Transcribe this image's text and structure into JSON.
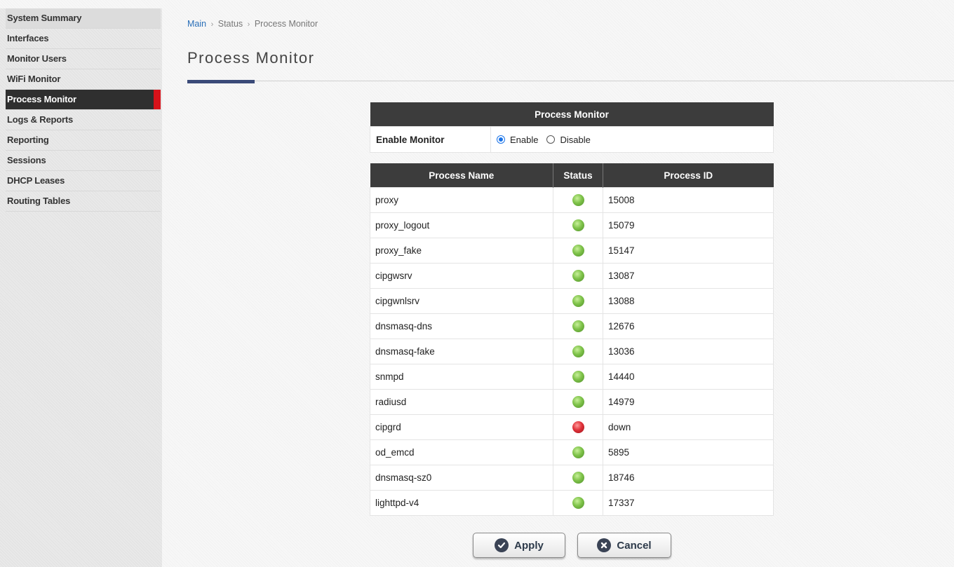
{
  "sidebar": {
    "items": [
      {
        "label": "System Summary"
      },
      {
        "label": "Interfaces"
      },
      {
        "label": "Monitor Users"
      },
      {
        "label": "WiFi Monitor"
      },
      {
        "label": "Process Monitor",
        "active": true
      },
      {
        "label": "Logs & Reports"
      },
      {
        "label": "Reporting"
      },
      {
        "label": "Sessions"
      },
      {
        "label": "DHCP Leases"
      },
      {
        "label": "Routing Tables"
      }
    ]
  },
  "breadcrumb": {
    "main": "Main",
    "sep1": "›",
    "status": "Status",
    "sep2": "›",
    "current": "Process Monitor"
  },
  "page_title": "Process Monitor",
  "monitor": {
    "header": "Process Monitor",
    "enable_label": "Enable Monitor",
    "enable_option": "Enable",
    "disable_option": "Disable",
    "selected": "Enable"
  },
  "processes": {
    "columns": [
      "Process Name",
      "Status",
      "Process ID"
    ],
    "rows": [
      {
        "name": "proxy",
        "status": "up",
        "pid": "15008"
      },
      {
        "name": "proxy_logout",
        "status": "up",
        "pid": "15079"
      },
      {
        "name": "proxy_fake",
        "status": "up",
        "pid": "15147"
      },
      {
        "name": "cipgwsrv",
        "status": "up",
        "pid": "13087"
      },
      {
        "name": "cipgwnlsrv",
        "status": "up",
        "pid": "13088"
      },
      {
        "name": "dnsmasq-dns",
        "status": "up",
        "pid": "12676"
      },
      {
        "name": "dnsmasq-fake",
        "status": "up",
        "pid": "13036"
      },
      {
        "name": "snmpd",
        "status": "up",
        "pid": "14440"
      },
      {
        "name": "radiusd",
        "status": "up",
        "pid": "14979"
      },
      {
        "name": "cipgrd",
        "status": "down",
        "pid": "down"
      },
      {
        "name": "od_emcd",
        "status": "up",
        "pid": "5895"
      },
      {
        "name": "dnsmasq-sz0",
        "status": "up",
        "pid": "18746"
      },
      {
        "name": "lighttpd-v4",
        "status": "up",
        "pid": "17337"
      }
    ]
  },
  "buttons": {
    "apply": "Apply",
    "cancel": "Cancel"
  },
  "colors": {
    "sidebar_active_bg": "#2f2f2f",
    "sidebar_active_marker": "#d7121a",
    "table_header_bg": "#3c3c3c",
    "title_accent": "#3a4a78",
    "status_up": "#7fc34a",
    "status_down": "#e0323a",
    "link": "#2a6fb8"
  }
}
